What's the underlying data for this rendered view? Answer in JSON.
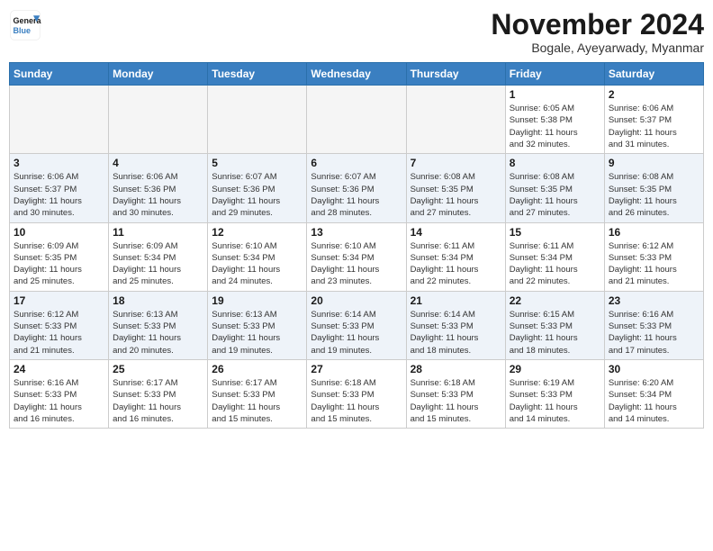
{
  "header": {
    "logo_line1": "General",
    "logo_line2": "Blue",
    "month": "November 2024",
    "location": "Bogale, Ayeyarwady, Myanmar"
  },
  "weekdays": [
    "Sunday",
    "Monday",
    "Tuesday",
    "Wednesday",
    "Thursday",
    "Friday",
    "Saturday"
  ],
  "weeks": [
    [
      {
        "day": "",
        "info": ""
      },
      {
        "day": "",
        "info": ""
      },
      {
        "day": "",
        "info": ""
      },
      {
        "day": "",
        "info": ""
      },
      {
        "day": "",
        "info": ""
      },
      {
        "day": "1",
        "info": "Sunrise: 6:05 AM\nSunset: 5:38 PM\nDaylight: 11 hours\nand 32 minutes."
      },
      {
        "day": "2",
        "info": "Sunrise: 6:06 AM\nSunset: 5:37 PM\nDaylight: 11 hours\nand 31 minutes."
      }
    ],
    [
      {
        "day": "3",
        "info": "Sunrise: 6:06 AM\nSunset: 5:37 PM\nDaylight: 11 hours\nand 30 minutes."
      },
      {
        "day": "4",
        "info": "Sunrise: 6:06 AM\nSunset: 5:36 PM\nDaylight: 11 hours\nand 30 minutes."
      },
      {
        "day": "5",
        "info": "Sunrise: 6:07 AM\nSunset: 5:36 PM\nDaylight: 11 hours\nand 29 minutes."
      },
      {
        "day": "6",
        "info": "Sunrise: 6:07 AM\nSunset: 5:36 PM\nDaylight: 11 hours\nand 28 minutes."
      },
      {
        "day": "7",
        "info": "Sunrise: 6:08 AM\nSunset: 5:35 PM\nDaylight: 11 hours\nand 27 minutes."
      },
      {
        "day": "8",
        "info": "Sunrise: 6:08 AM\nSunset: 5:35 PM\nDaylight: 11 hours\nand 27 minutes."
      },
      {
        "day": "9",
        "info": "Sunrise: 6:08 AM\nSunset: 5:35 PM\nDaylight: 11 hours\nand 26 minutes."
      }
    ],
    [
      {
        "day": "10",
        "info": "Sunrise: 6:09 AM\nSunset: 5:35 PM\nDaylight: 11 hours\nand 25 minutes."
      },
      {
        "day": "11",
        "info": "Sunrise: 6:09 AM\nSunset: 5:34 PM\nDaylight: 11 hours\nand 25 minutes."
      },
      {
        "day": "12",
        "info": "Sunrise: 6:10 AM\nSunset: 5:34 PM\nDaylight: 11 hours\nand 24 minutes."
      },
      {
        "day": "13",
        "info": "Sunrise: 6:10 AM\nSunset: 5:34 PM\nDaylight: 11 hours\nand 23 minutes."
      },
      {
        "day": "14",
        "info": "Sunrise: 6:11 AM\nSunset: 5:34 PM\nDaylight: 11 hours\nand 22 minutes."
      },
      {
        "day": "15",
        "info": "Sunrise: 6:11 AM\nSunset: 5:34 PM\nDaylight: 11 hours\nand 22 minutes."
      },
      {
        "day": "16",
        "info": "Sunrise: 6:12 AM\nSunset: 5:33 PM\nDaylight: 11 hours\nand 21 minutes."
      }
    ],
    [
      {
        "day": "17",
        "info": "Sunrise: 6:12 AM\nSunset: 5:33 PM\nDaylight: 11 hours\nand 21 minutes."
      },
      {
        "day": "18",
        "info": "Sunrise: 6:13 AM\nSunset: 5:33 PM\nDaylight: 11 hours\nand 20 minutes."
      },
      {
        "day": "19",
        "info": "Sunrise: 6:13 AM\nSunset: 5:33 PM\nDaylight: 11 hours\nand 19 minutes."
      },
      {
        "day": "20",
        "info": "Sunrise: 6:14 AM\nSunset: 5:33 PM\nDaylight: 11 hours\nand 19 minutes."
      },
      {
        "day": "21",
        "info": "Sunrise: 6:14 AM\nSunset: 5:33 PM\nDaylight: 11 hours\nand 18 minutes."
      },
      {
        "day": "22",
        "info": "Sunrise: 6:15 AM\nSunset: 5:33 PM\nDaylight: 11 hours\nand 18 minutes."
      },
      {
        "day": "23",
        "info": "Sunrise: 6:16 AM\nSunset: 5:33 PM\nDaylight: 11 hours\nand 17 minutes."
      }
    ],
    [
      {
        "day": "24",
        "info": "Sunrise: 6:16 AM\nSunset: 5:33 PM\nDaylight: 11 hours\nand 16 minutes."
      },
      {
        "day": "25",
        "info": "Sunrise: 6:17 AM\nSunset: 5:33 PM\nDaylight: 11 hours\nand 16 minutes."
      },
      {
        "day": "26",
        "info": "Sunrise: 6:17 AM\nSunset: 5:33 PM\nDaylight: 11 hours\nand 15 minutes."
      },
      {
        "day": "27",
        "info": "Sunrise: 6:18 AM\nSunset: 5:33 PM\nDaylight: 11 hours\nand 15 minutes."
      },
      {
        "day": "28",
        "info": "Sunrise: 6:18 AM\nSunset: 5:33 PM\nDaylight: 11 hours\nand 15 minutes."
      },
      {
        "day": "29",
        "info": "Sunrise: 6:19 AM\nSunset: 5:33 PM\nDaylight: 11 hours\nand 14 minutes."
      },
      {
        "day": "30",
        "info": "Sunrise: 6:20 AM\nSunset: 5:34 PM\nDaylight: 11 hours\nand 14 minutes."
      }
    ]
  ]
}
